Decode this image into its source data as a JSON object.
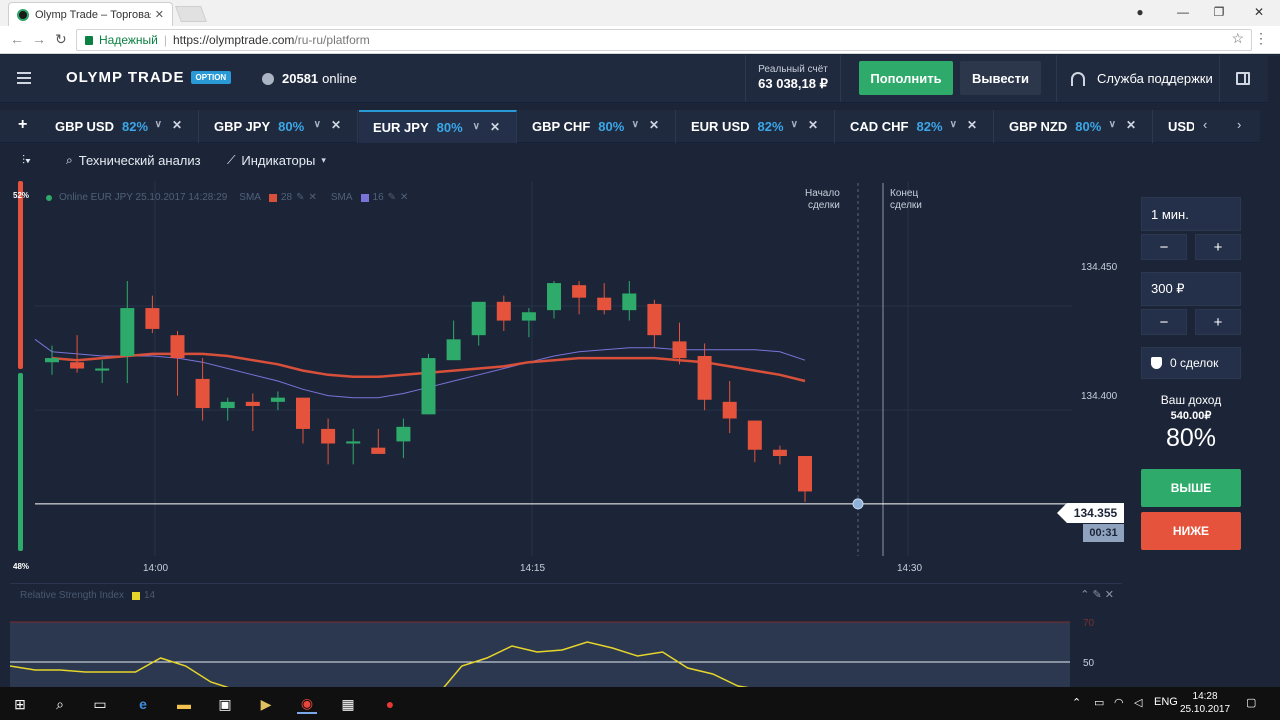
{
  "browser": {
    "tab_title": "Olymp Trade – Торговая",
    "tab_close": "✕",
    "secure_label": "Надежный",
    "url_host": "https://olymptrade.com",
    "url_path": "/ru-ru/platform",
    "window_min": "—",
    "window_max": "❐",
    "window_close": "✕"
  },
  "header": {
    "logo": "OLYMP TRADE",
    "logo_badge": "OPTION",
    "online_count": "20581",
    "online_label": "online",
    "balance_label": "Реальный счёт",
    "balance_value": "63 038,18 ₽",
    "deposit_label": "Пополнить",
    "withdraw_label": "Вывести",
    "support_label": "Служба поддержки"
  },
  "assets": [
    {
      "name": "GBP USD",
      "pct": "82%"
    },
    {
      "name": "GBP JPY",
      "pct": "80%"
    },
    {
      "name": "EUR JPY",
      "pct": "80%",
      "active": true
    },
    {
      "name": "GBP CHF",
      "pct": "80%"
    },
    {
      "name": "EUR USD",
      "pct": "82%"
    },
    {
      "name": "CAD CHF",
      "pct": "82%"
    },
    {
      "name": "GBP NZD",
      "pct": "80%"
    },
    {
      "name": "USD",
      "pct": ""
    }
  ],
  "toolbar": {
    "tech_analysis": "Технический анализ",
    "indicators": "Индикаторы"
  },
  "chart": {
    "legend_online": "Online EUR JPY 25.10.2017 14:28:29",
    "sma1_label": "SMA",
    "sma1_period": "28",
    "sma2_label": "SMA",
    "sma2_period": "16",
    "pct_top": "52%",
    "pct_bottom": "48%",
    "deal_start": [
      "Начало",
      "сделки"
    ],
    "deal_end": [
      "Конец",
      "сделки"
    ],
    "price_tag": "134.355",
    "timer": "00:31"
  },
  "chart_data": {
    "type": "candlestick",
    "x_ticks": [
      "14:00",
      "14:15",
      "14:30"
    ],
    "y_ticks": [
      134.45,
      134.4
    ],
    "y_tick_labels": [
      "134.450",
      "134.400"
    ],
    "ylim": [
      134.33,
      134.51
    ],
    "current_price": 134.355,
    "colors": {
      "up": "#2eab6b",
      "down": "#e5533c",
      "sma28": "#d9503a",
      "sma16": "#7b73d9"
    },
    "candles": [
      {
        "t": 0,
        "o": 134.423,
        "h": 134.431,
        "l": 134.417,
        "c": 134.425
      },
      {
        "t": 1,
        "o": 134.423,
        "h": 134.436,
        "l": 134.418,
        "c": 134.42
      },
      {
        "t": 2,
        "o": 134.419,
        "h": 134.424,
        "l": 134.413,
        "c": 134.42
      },
      {
        "t": 3,
        "o": 134.426,
        "h": 134.462,
        "l": 134.413,
        "c": 134.449
      },
      {
        "t": 4,
        "o": 134.449,
        "h": 134.455,
        "l": 134.437,
        "c": 134.439
      },
      {
        "t": 5,
        "o": 134.436,
        "h": 134.438,
        "l": 134.407,
        "c": 134.425
      },
      {
        "t": 6,
        "o": 134.415,
        "h": 134.425,
        "l": 134.395,
        "c": 134.401
      },
      {
        "t": 7,
        "o": 134.401,
        "h": 134.406,
        "l": 134.395,
        "c": 134.404
      },
      {
        "t": 8,
        "o": 134.404,
        "h": 134.408,
        "l": 134.39,
        "c": 134.402
      },
      {
        "t": 9,
        "o": 134.404,
        "h": 134.409,
        "l": 134.4,
        "c": 134.406
      },
      {
        "t": 10,
        "o": 134.406,
        "h": 134.406,
        "l": 134.384,
        "c": 134.391
      },
      {
        "t": 11,
        "o": 134.391,
        "h": 134.396,
        "l": 134.374,
        "c": 134.384
      },
      {
        "t": 12,
        "o": 134.384,
        "h": 134.391,
        "l": 134.374,
        "c": 134.385
      },
      {
        "t": 13,
        "o": 134.382,
        "h": 134.391,
        "l": 134.38,
        "c": 134.379
      },
      {
        "t": 14,
        "o": 134.385,
        "h": 134.396,
        "l": 134.377,
        "c": 134.392
      },
      {
        "t": 15,
        "o": 134.398,
        "h": 134.427,
        "l": 134.398,
        "c": 134.425
      },
      {
        "t": 16,
        "o": 134.424,
        "h": 134.443,
        "l": 134.424,
        "c": 134.434
      },
      {
        "t": 17,
        "o": 134.436,
        "h": 134.452,
        "l": 134.431,
        "c": 134.452
      },
      {
        "t": 18,
        "o": 134.452,
        "h": 134.455,
        "l": 134.438,
        "c": 134.443
      },
      {
        "t": 19,
        "o": 134.443,
        "h": 134.449,
        "l": 134.435,
        "c": 134.447
      },
      {
        "t": 20,
        "o": 134.448,
        "h": 134.462,
        "l": 134.444,
        "c": 134.461
      },
      {
        "t": 21,
        "o": 134.46,
        "h": 134.462,
        "l": 134.446,
        "c": 134.454
      },
      {
        "t": 22,
        "o": 134.454,
        "h": 134.461,
        "l": 134.446,
        "c": 134.448
      },
      {
        "t": 23,
        "o": 134.448,
        "h": 134.462,
        "l": 134.443,
        "c": 134.456
      },
      {
        "t": 24,
        "o": 134.451,
        "h": 134.453,
        "l": 134.43,
        "c": 134.436
      },
      {
        "t": 25,
        "o": 134.433,
        "h": 134.442,
        "l": 134.422,
        "c": 134.425
      },
      {
        "t": 26,
        "o": 134.426,
        "h": 134.432,
        "l": 134.4,
        "c": 134.405
      },
      {
        "t": 27,
        "o": 134.404,
        "h": 134.414,
        "l": 134.389,
        "c": 134.396
      },
      {
        "t": 28,
        "o": 134.395,
        "h": 134.395,
        "l": 134.375,
        "c": 134.381
      },
      {
        "t": 29,
        "o": 134.381,
        "h": 134.383,
        "l": 134.374,
        "c": 134.378
      },
      {
        "t": 30,
        "o": 134.378,
        "h": 134.378,
        "l": 134.356,
        "c": 134.361
      }
    ],
    "sma28": [
      134.425,
      134.424,
      134.425,
      134.426,
      134.427,
      134.427,
      134.427,
      134.426,
      134.424,
      134.422,
      134.419,
      134.417,
      134.416,
      134.416,
      134.417,
      134.418,
      134.419,
      134.42,
      134.421,
      134.423,
      134.424,
      134.425,
      134.425,
      134.425,
      134.425,
      134.424,
      134.423,
      134.421,
      134.419,
      134.417,
      134.414
    ],
    "sma16": [
      134.428,
      134.427,
      134.426,
      134.426,
      134.426,
      134.425,
      134.423,
      134.42,
      134.417,
      134.414,
      134.41,
      134.407,
      134.406,
      134.406,
      134.408,
      134.411,
      134.414,
      134.417,
      134.42,
      134.423,
      134.426,
      134.428,
      134.429,
      134.43,
      134.43,
      134.429,
      134.429,
      134.429,
      134.429,
      134.428,
      134.424
    ]
  },
  "rsi": {
    "title": "Relative Strength Index",
    "period": "14",
    "level_70": "70",
    "level_50": "50",
    "values": [
      48,
      46,
      46,
      45,
      45,
      45,
      52,
      48,
      40,
      36,
      35,
      34,
      33,
      30,
      31,
      29,
      29,
      33,
      48,
      52,
      58,
      55,
      56,
      60,
      57,
      53,
      55,
      47,
      44,
      38,
      36,
      32,
      28,
      26,
      24
    ]
  },
  "trade_panel": {
    "time_value": "1 мин.",
    "amount_value": "300 ₽",
    "minus": "−",
    "plus": "+",
    "deals_label": "0 сделок",
    "income_label": "Ваш доход",
    "income_value": "540.00₽",
    "income_pct": "80%",
    "up_label": "ВЫШЕ",
    "down_label": "НИЖЕ"
  },
  "taskbar": {
    "lang": "ENG",
    "time": "14:28",
    "date": "25.10.2017"
  }
}
